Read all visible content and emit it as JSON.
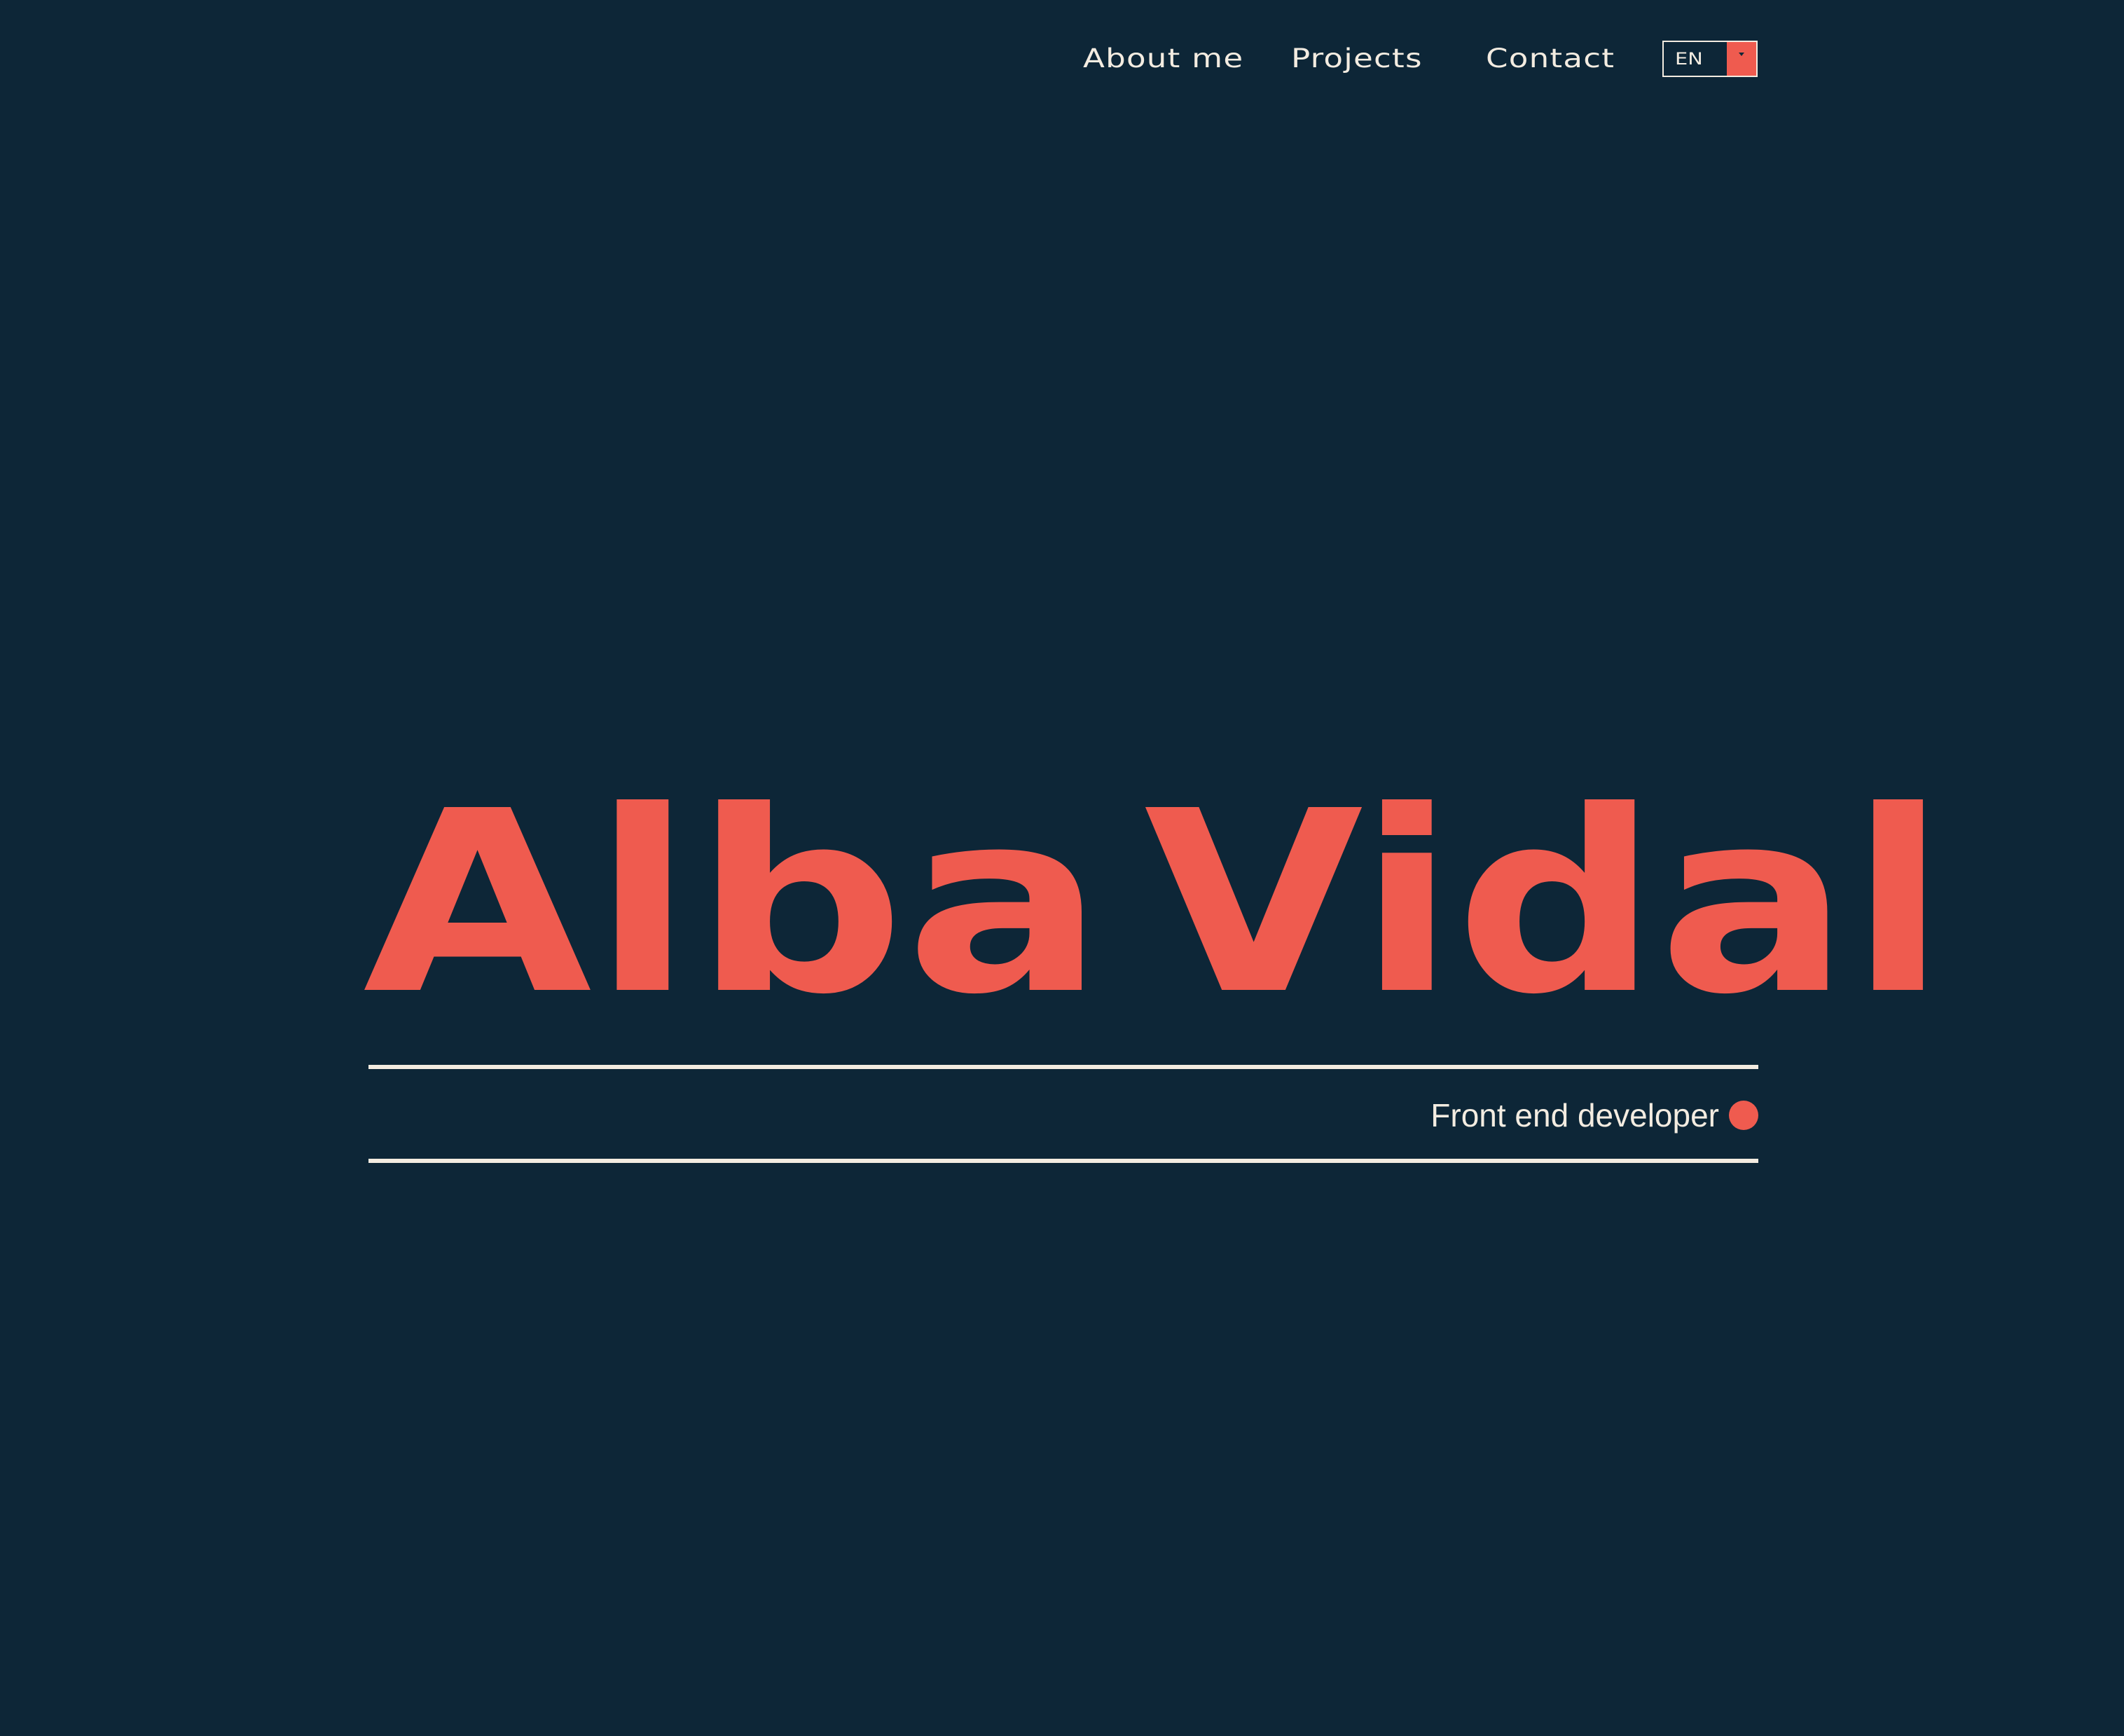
{
  "nav": {
    "items": [
      {
        "label": "About me"
      },
      {
        "label": "Projects"
      },
      {
        "label": "Contact"
      }
    ]
  },
  "language": {
    "selected": "EN"
  },
  "hero": {
    "first_name": "Alba",
    "last_name": "Vidal",
    "role": "Front end developer"
  },
  "colors": {
    "background": "#0d2637",
    "accent": "#ef5b4f",
    "text": "#f3ece1"
  }
}
